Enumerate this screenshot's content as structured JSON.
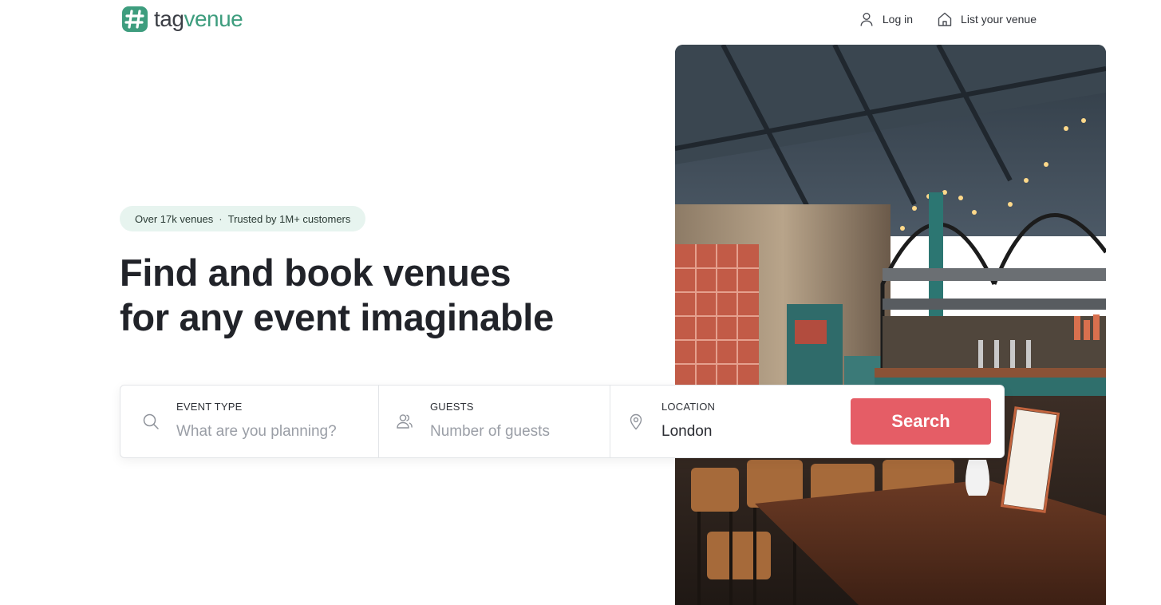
{
  "brand": {
    "name_part1": "tag",
    "name_part2": "venue",
    "accent": "#3e9d7e"
  },
  "nav": {
    "login_label": "Log in",
    "list_venue_label": "List your venue"
  },
  "hero": {
    "badge_left": "Over 17k venues",
    "badge_sep": "·",
    "badge_right": "Trusted by 1M+ customers",
    "headline_line1": "Find and book venues",
    "headline_line2": "for any event imaginable"
  },
  "search": {
    "event_label": "EVENT TYPE",
    "event_placeholder": "What are you planning?",
    "guests_label": "GUESTS",
    "guests_placeholder": "Number of guests",
    "location_label": "LOCATION",
    "location_value": "London",
    "button_label": "Search",
    "button_color": "#e55d66"
  }
}
